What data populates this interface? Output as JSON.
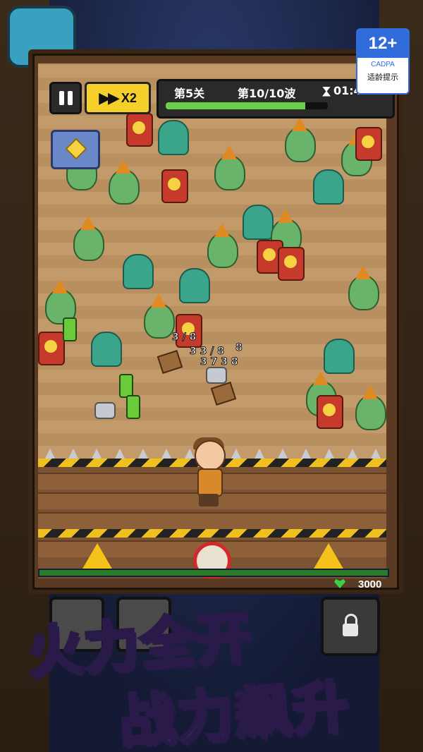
{
  "hud": {
    "speed_label": "X2",
    "level_label": "第5关",
    "wave_label": "第10/10波",
    "timer_label": "01:42",
    "wave_progress": 0.86
  },
  "age_rating": {
    "age": "12+",
    "org": "CADPA",
    "hint": "适龄提示"
  },
  "base": {
    "hp_value": "3000"
  },
  "damage_numbers": [
    "3 / 8",
    "3 3 / 8",
    "3 7 3 8",
    "8"
  ],
  "promo": {
    "line1": "火力全开",
    "line2": "战力飙升"
  },
  "colors": {
    "accent_yellow": "#f6d02a",
    "hp_green": "#3ad04a",
    "promo_yellow": "#ffe24a",
    "promo_blue": "#6fd0ff"
  },
  "icons": [
    "pause-icon",
    "fast-forward-icon",
    "hourglass-icon",
    "treasure-chest-icon",
    "lock-icon",
    "heart-icon"
  ]
}
